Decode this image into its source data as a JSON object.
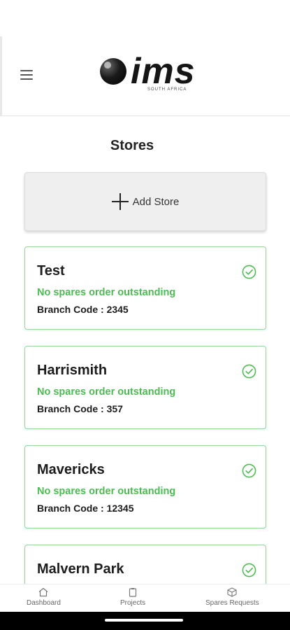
{
  "header": {
    "logo_text": "ims",
    "logo_sub": "SOUTH AFRICA"
  },
  "page": {
    "title": "Stores"
  },
  "add_store": {
    "label": "Add Store"
  },
  "stores": [
    {
      "name": "Test",
      "status": "No spares order outstanding",
      "branch": "Branch Code : 2345"
    },
    {
      "name": "Harrismith",
      "status": "No spares order outstanding",
      "branch": "Branch Code : 357"
    },
    {
      "name": "Mavericks",
      "status": "No spares order outstanding",
      "branch": "Branch Code : 12345"
    },
    {
      "name": "Malvern Park",
      "status": "",
      "branch": ""
    }
  ],
  "bottom_nav": {
    "items": [
      {
        "label": "Dashboard",
        "icon": "home-icon"
      },
      {
        "label": "Projects",
        "icon": "clipboard-icon"
      },
      {
        "label": "Spares Requests",
        "icon": "cube-icon"
      }
    ]
  },
  "colors": {
    "accent_green": "#4cbb52",
    "card_border": "#9ad79a"
  }
}
